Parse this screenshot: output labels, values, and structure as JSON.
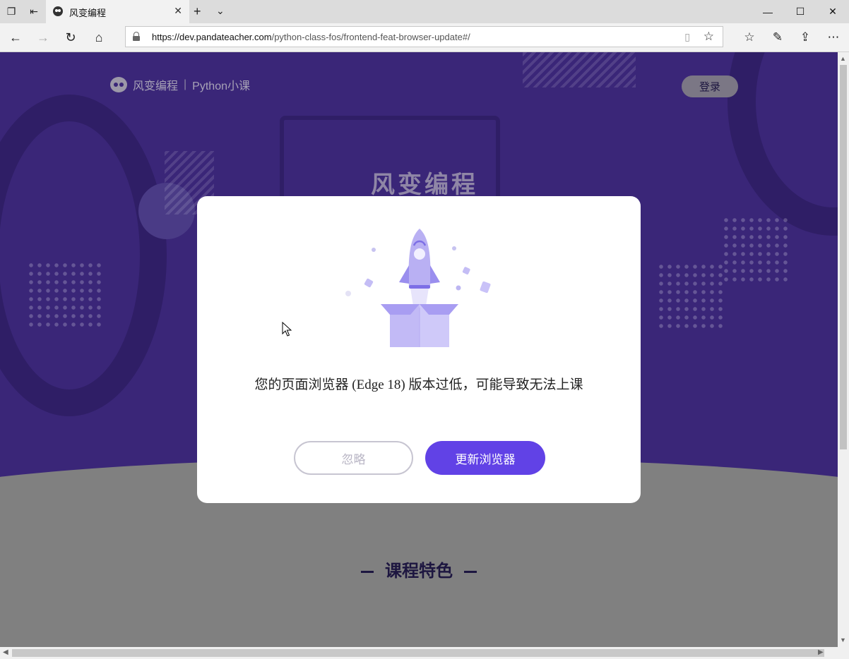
{
  "browser": {
    "tab_title": "风变编程",
    "url_host": "https://dev.pandateacher.com",
    "url_path": "/python-class-fos/frontend-feat-browser-update#/",
    "icons": [
      "tab-list-icon",
      "set-aside-icon",
      "new-tab-icon",
      "tab-menu-icon",
      "minimize-icon",
      "maximize-icon",
      "close-icon",
      "back-icon",
      "forward-icon",
      "refresh-icon",
      "home-icon",
      "lock-icon",
      "reading-view-icon",
      "favorite-star-icon",
      "favorites-icon",
      "pen-icon",
      "share-icon",
      "more-icon"
    ]
  },
  "page": {
    "logo_brand": "风变编程",
    "logo_separator": "|",
    "logo_product": "Python小课",
    "login_label": "登录",
    "hero_brand": "风变编程",
    "section_title": "课程特色"
  },
  "modal": {
    "message": "您的页面浏览器 (Edge 18) 版本过低，可能导致无法上课",
    "ignore_label": "忽略",
    "update_label": "更新浏览器"
  },
  "colors": {
    "hero_bg": "#3a2678",
    "primary": "#6142e6",
    "overlay_gray": "#808080"
  }
}
